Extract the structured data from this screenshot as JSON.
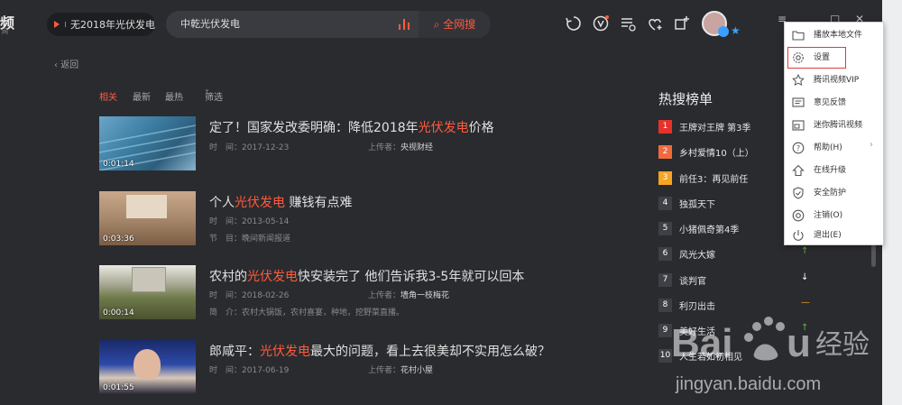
{
  "app": {
    "logo_text": "频",
    "logo_sub": "网",
    "now_playing": "无2018年光伏发电",
    "search": {
      "query": "中乾光伏发电",
      "button_label": "全网搜"
    },
    "back_label": "返回"
  },
  "filters": [
    "相关",
    "最新",
    "最热",
    "筛选"
  ],
  "results": [
    {
      "title_prefix": "定了！国家发改委明确：降低2018年",
      "title_highlight": "光伏发电",
      "title_suffix": "价格",
      "duration": "0:01:14",
      "time_label": "时　间：",
      "time": "2017-12-23",
      "uploader_label": "上传者：",
      "uploader": "央视财经"
    },
    {
      "title_prefix": "个人",
      "title_highlight": "光伏发电",
      "title_suffix": " 赚钱有点难",
      "duration": "0:03:36",
      "time_label": "时　间：",
      "time": "2013-05-14",
      "extra_label": "节　目：",
      "extra": "晚间新闻报道"
    },
    {
      "title_prefix": "农村的",
      "title_highlight": "光伏发电",
      "title_suffix": "快安装完了 他们告诉我3-5年就可以回本",
      "duration": "0:00:14",
      "time_label": "时　间：",
      "time": "2018-02-26",
      "uploader_label": "上传者：",
      "uploader": "墙角一枝梅花",
      "extra_label": "简　介：",
      "extra": "农村大锅饭，农村喜宴，种地，挖野菜直播。"
    },
    {
      "title_prefix": "郎咸平：",
      "title_highlight": "光伏发电",
      "title_suffix": "最大的问题，看上去很美却不实用怎么破？",
      "duration": "0:01:55",
      "time_label": "时　间：",
      "time": "2017-06-19",
      "uploader_label": "上传者：",
      "uploader": "花村小屋"
    }
  ],
  "hot": {
    "title": "热搜榜单",
    "items": [
      {
        "rank": "1",
        "name": "王牌对王牌 第3季",
        "color": "#e5322d"
      },
      {
        "rank": "2",
        "name": "乡村爱情10（上）",
        "color": "#f26a3c"
      },
      {
        "rank": "3",
        "name": "前任3：再见前任",
        "color": "#f6a623"
      },
      {
        "rank": "4",
        "name": "独孤天下",
        "color": "#3f4046"
      },
      {
        "rank": "5",
        "name": "小猪佩奇第4季",
        "color": "#3f4046"
      },
      {
        "rank": "6",
        "name": "风光大嫁",
        "color": "#3f4046",
        "trend": "↑",
        "trend_color": "#5dbb3b"
      },
      {
        "rank": "7",
        "name": "谈判官",
        "color": "#3f4046",
        "trend": "↓",
        "trend_color": "#ffffff"
      },
      {
        "rank": "8",
        "name": "利刃出击",
        "color": "#3f4046",
        "trend": "—",
        "trend_color": "#f6a623"
      },
      {
        "rank": "9",
        "name": "美好生活",
        "color": "#3f4046",
        "trend": "↑",
        "trend_color": "#5dbb3b"
      },
      {
        "rank": "10",
        "name": "人生若如初相见",
        "color": "#3f4046"
      }
    ]
  },
  "menu": [
    {
      "label": "播放本地文件",
      "icon": "folder-icon"
    },
    {
      "label": "设置",
      "icon": "gear-icon"
    },
    {
      "label": "腾讯视频VIP",
      "icon": "star-icon"
    },
    {
      "label": "意见反馈",
      "icon": "feedback-icon"
    },
    {
      "label": "迷你腾讯视频",
      "icon": "mini-player-icon"
    },
    {
      "label": "帮助(H)",
      "icon": "help-icon"
    },
    {
      "label": "在线升级",
      "icon": "upgrade-icon"
    },
    {
      "label": "安全防护",
      "icon": "shield-icon"
    },
    {
      "label": "注销(O)",
      "icon": "logout-icon"
    },
    {
      "label": "退出(E)",
      "icon": "power-icon"
    }
  ],
  "watermark": {
    "brand": "Baidu经验",
    "url": "jingyan.baidu.com"
  },
  "colors": {
    "accent": "#ff5a3c",
    "background": "#2a2b2f",
    "selection_border": "#e23a3a"
  }
}
